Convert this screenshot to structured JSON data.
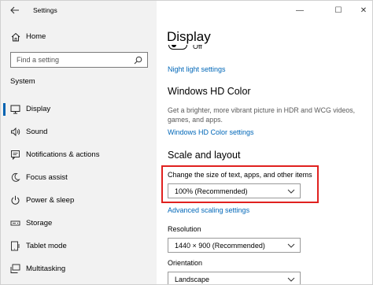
{
  "window": {
    "title": "Settings",
    "controls": {
      "minimize": "—",
      "maximize": "☐",
      "close": "✕"
    }
  },
  "sidebar": {
    "back_icon": "back-arrow-icon",
    "home_label": "Home",
    "search_placeholder": "Find a setting",
    "section_label": "System",
    "items": [
      {
        "label": "Display",
        "icon": "monitor-icon",
        "active": true
      },
      {
        "label": "Sound",
        "icon": "speaker-icon",
        "active": false
      },
      {
        "label": "Notifications & actions",
        "icon": "notification-icon",
        "active": false
      },
      {
        "label": "Focus assist",
        "icon": "moon-icon",
        "active": false
      },
      {
        "label": "Power & sleep",
        "icon": "power-icon",
        "active": false
      },
      {
        "label": "Storage",
        "icon": "storage-icon",
        "active": false
      },
      {
        "label": "Tablet mode",
        "icon": "tablet-icon",
        "active": false
      },
      {
        "label": "Multitasking",
        "icon": "multitasking-icon",
        "active": false
      }
    ]
  },
  "main": {
    "title": "Display",
    "night_light": {
      "state": "Off",
      "settings_link": "Night light settings"
    },
    "hd_color": {
      "heading": "Windows HD Color",
      "description": "Get a brighter, more vibrant picture in HDR and WCG videos, games, and apps.",
      "settings_link": "Windows HD Color settings"
    },
    "scale_layout": {
      "heading": "Scale and layout",
      "scale_label": "Change the size of text, apps, and other items",
      "scale_value": "100% (Recommended)",
      "advanced_link": "Advanced scaling settings",
      "resolution_label": "Resolution",
      "resolution_value": "1440 × 900 (Recommended)",
      "orientation_label": "Orientation",
      "orientation_value": "Landscape"
    }
  },
  "colors": {
    "accent": "#0063b1",
    "link": "#0067b8",
    "highlight": "#e0211f",
    "sidebar_bg": "#f2f2f2"
  }
}
